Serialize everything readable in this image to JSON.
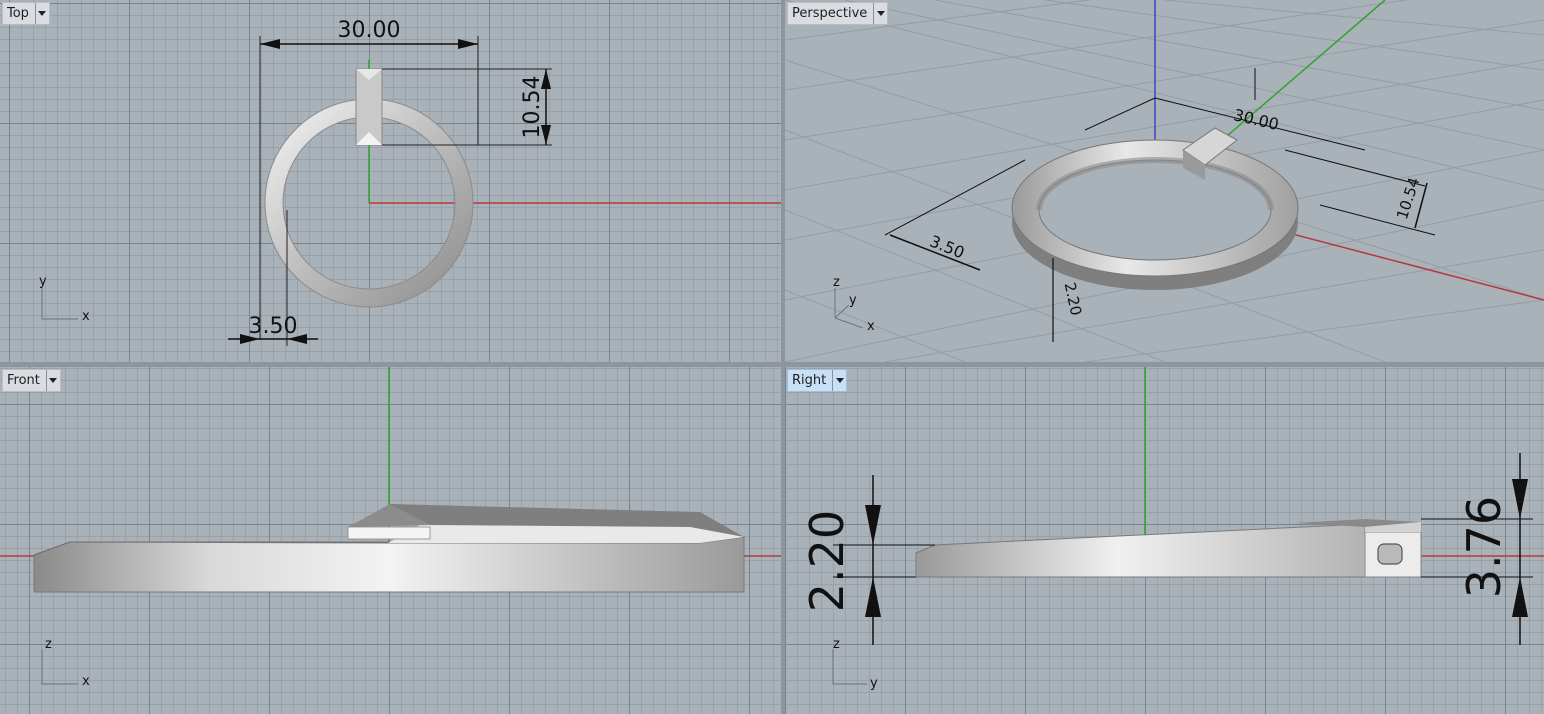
{
  "viewports": {
    "top": {
      "title": "Top",
      "dimensions": {
        "width": "30.00",
        "height": "10.54",
        "wall": "3.50"
      },
      "axis_labels": {
        "vertical": "y",
        "horizontal": "x"
      }
    },
    "perspective": {
      "title": "Perspective",
      "dimensions": {
        "width": "30.00",
        "height": "10.54",
        "wall": "3.50",
        "thickness": "2.20"
      },
      "axis_labels": {
        "z": "z",
        "y": "y",
        "x": "x"
      }
    },
    "front": {
      "title": "Front",
      "axis_labels": {
        "vertical": "z",
        "horizontal": "x"
      }
    },
    "right": {
      "title": "Right",
      "active": true,
      "dimensions": {
        "thickness": "2.20",
        "tab_height": "3.76"
      },
      "axis_labels": {
        "vertical": "z",
        "horizontal": "y"
      }
    }
  },
  "colors": {
    "x_axis": "#b33a3a",
    "y_axis": "#2fa52f",
    "z_axis": "#3a44c8",
    "viewport_background": "#a9b1b9",
    "active_tab": "#c8dff5"
  }
}
